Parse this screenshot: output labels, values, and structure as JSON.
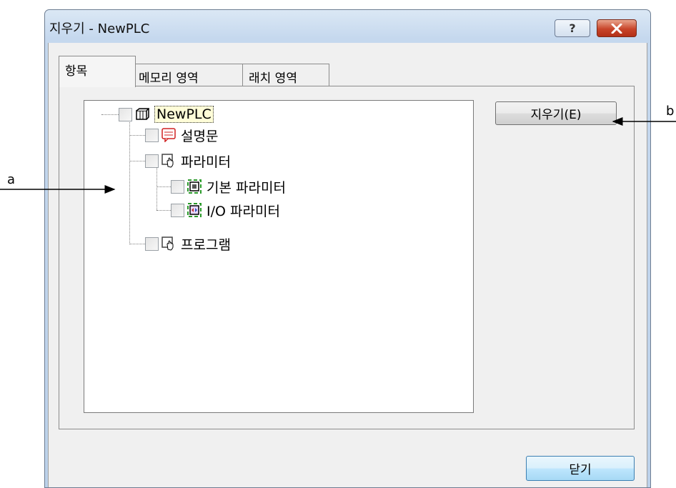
{
  "window": {
    "title": "지우기 - NewPLC",
    "help_label": "?"
  },
  "tabs": [
    {
      "label": "항목",
      "active": true
    },
    {
      "label": "메모리 영역",
      "active": false
    },
    {
      "label": "래치 영역",
      "active": false
    }
  ],
  "tree": {
    "root": {
      "label": "NewPLC",
      "icon": "plc-icon",
      "checked": false
    },
    "children": [
      {
        "label": "설명문",
        "icon": "comment-icon",
        "checked": false
      },
      {
        "label": "파라미터",
        "icon": "parameter-icon",
        "checked": false,
        "children": [
          {
            "label": "기본 파라미터",
            "icon": "basic-parameter-icon",
            "checked": false
          },
          {
            "label": "I/O 파라미터",
            "icon": "io-parameter-icon",
            "checked": false
          }
        ]
      },
      {
        "label": "프로그램",
        "icon": "program-icon",
        "checked": false
      }
    ]
  },
  "buttons": {
    "erase": "지우기(E)",
    "close": "닫기"
  },
  "annotations": {
    "a": "a",
    "b": "b"
  }
}
